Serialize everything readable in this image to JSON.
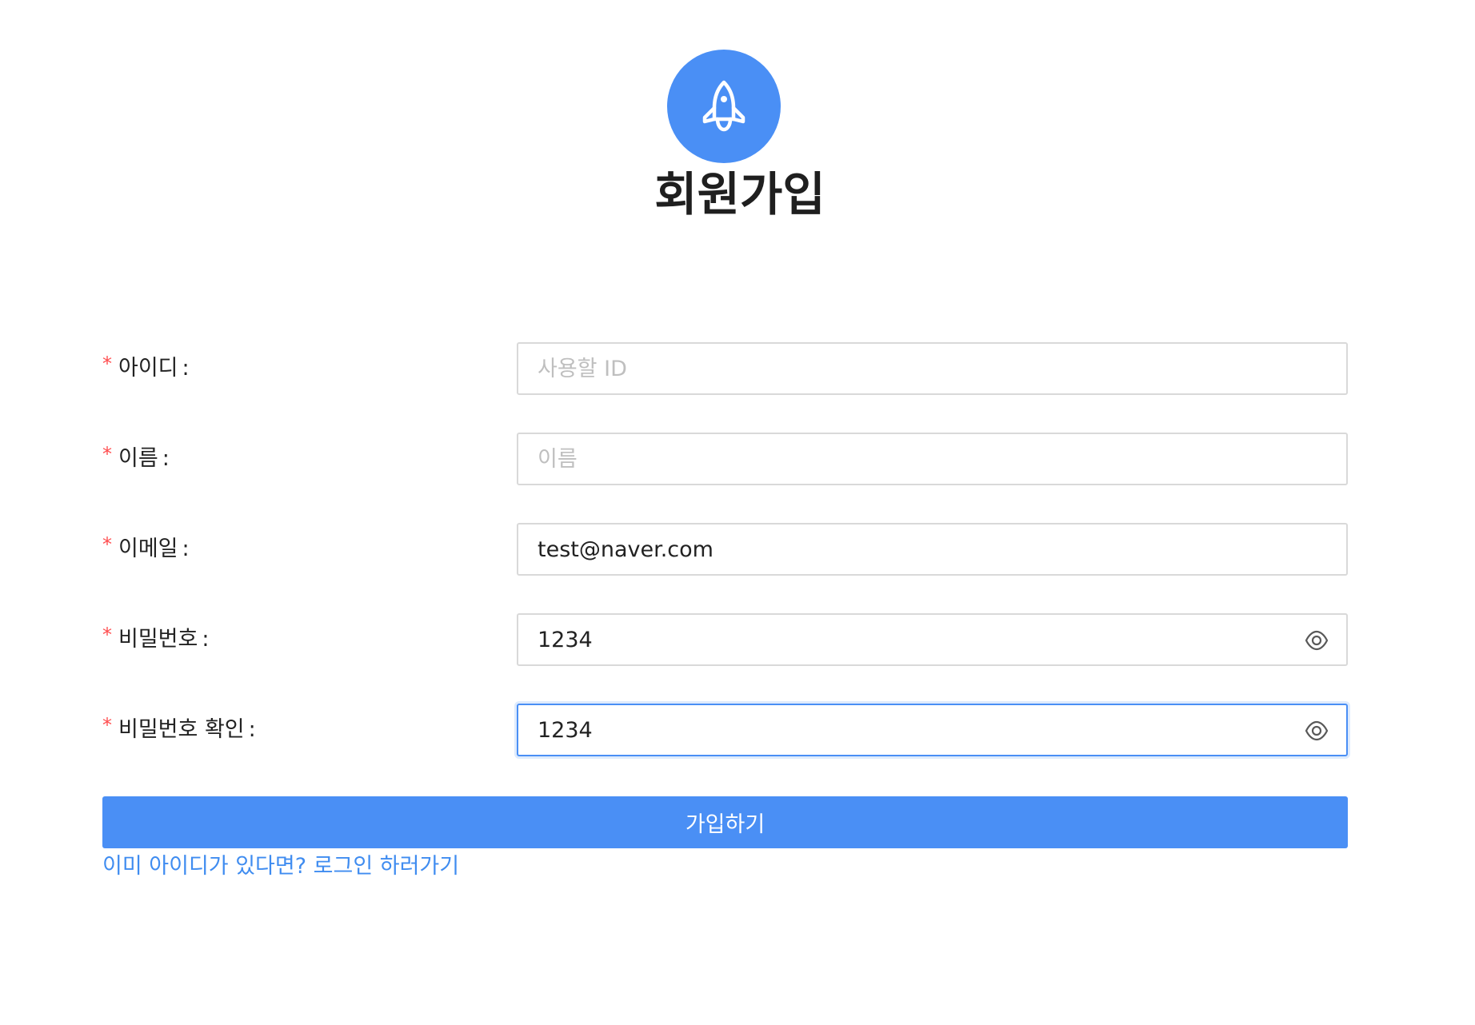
{
  "header": {
    "logo_icon": "rocket-icon",
    "title": "회원가입"
  },
  "form": {
    "required_mark": "*",
    "colon": ":",
    "fields": {
      "id": {
        "label": "아이디",
        "placeholder": "사용할 ID",
        "value": ""
      },
      "name": {
        "label": "이름",
        "placeholder": "이름",
        "value": ""
      },
      "email": {
        "label": "이메일",
        "placeholder": "",
        "value": "test@naver.com"
      },
      "password": {
        "label": "비밀번호",
        "value": "1234",
        "toggle_icon": "eye-icon"
      },
      "password_confirm": {
        "label": "비밀번호 확인",
        "value": "1234",
        "toggle_icon": "eye-icon",
        "focused": true
      }
    },
    "submit_label": "가입하기",
    "login_link": "이미 아이디가 있다면? 로그인 하러가기"
  },
  "colors": {
    "primary": "#4a8ff5",
    "required": "#ff4d4f",
    "link": "#3f8cf0",
    "border": "#d9d9d9"
  }
}
